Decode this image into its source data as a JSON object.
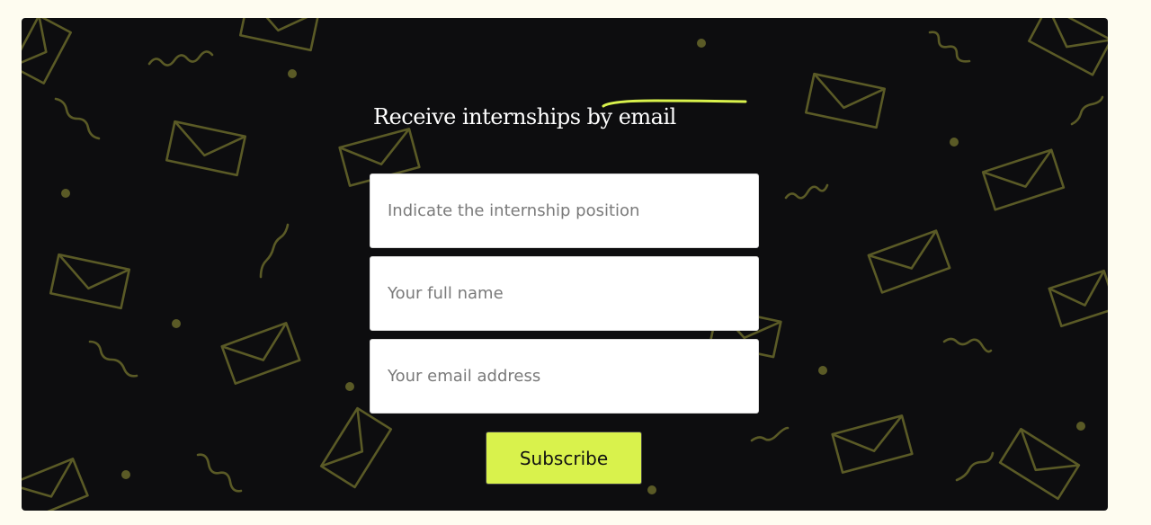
{
  "newsletter": {
    "heading": "Receive internships by email",
    "position_placeholder": "Indicate the internship position",
    "name_placeholder": "Your full name",
    "email_placeholder": "Your email address",
    "subscribe_label": "Subscribe"
  },
  "colors": {
    "page_background": "#fefcf0",
    "card_background": "#0d0d0f",
    "pattern": "#5a5a26",
    "accent": "#d9f24c"
  }
}
